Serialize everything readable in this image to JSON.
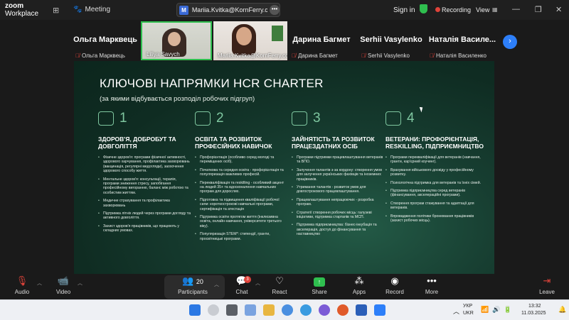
{
  "app": {
    "logo_line1": "zoom",
    "logo_line2": "Workplace",
    "meeting_label": "Meeting",
    "shared_by": "Mariia.Kvitka@KornFerry.com's sc",
    "shared_badge": "M",
    "sign_in": "Sign in",
    "recording": "Recording",
    "view": "View"
  },
  "participants": [
    {
      "big_name": "Ольга Марквець",
      "name": "Ольга Марквець",
      "muted": true,
      "video": false
    },
    {
      "big_name": "",
      "name": "Liliya Savych",
      "muted": false,
      "video": true
    },
    {
      "big_name": "",
      "name": "Mariia.Kvitka@KornFerry.com",
      "muted": false,
      "video": true
    },
    {
      "big_name": "Дарина Багмет",
      "name": "Дарина Багмет",
      "muted": true,
      "video": false
    },
    {
      "big_name": "Serhii Vasylenko",
      "name": "Serhii Vasylenko",
      "muted": true,
      "video": false
    },
    {
      "big_name": "Наталія Василе...",
      "name": "Наталія Василенко",
      "muted": true,
      "video": false
    }
  ],
  "slide": {
    "title": "КЛЮЧОВІ НАПРЯМКИ HCR CHARTER",
    "subtitle": "(за якими відбувається розподіл робочих підгруп)",
    "columns": [
      {
        "number": "1",
        "icon": "heart-icon",
        "title": "ЗДОРОВ'Я, ДОБРОБУТ ТА ДОВГОЛІТТЯ",
        "bullets": [
          "Фізичне здоров'я: програми фізичної активності, здорового харчування, профілактика захворювань (вакцинація, регулярні медогляди), заохочення здорового способу життя.",
          "Ментальне здоров'я: консультації, терапія, програми зниження стресу, запобігання професійному вигоранню, баланс між роботою та особистим життям.",
          "Медичне страхування та профілактика захворювань",
          "Підтримка літніх людей через програми догляду та активного довголіття.",
          "Захист здоров'я працівників, що працюють у складних умовах."
        ]
      },
      {
        "number": "2",
        "icon": "brain-icon",
        "title": "ОСВІТА ТА РОЗВИТОК ПРОФЕСІЙНИХ НАВИЧОК",
        "bullets": [
          "Профорієнтація (особливо серед молоді та переміщених осіб).",
          "Початкова та середня освіта - профорієнтація та популяризація важливих професій.",
          "Перекваліфікація та reskilling - особливий акцент на людей 35+ та вдосконалення навчальних програм для дорослих.",
          "Підготовка та підвищення кваліфікації робочої сили: короткострокові навчальні програми, сертифікація та атестація",
          "Підтримка освіти протягом життя (інклюзивна освіта, онлайн-навчання, університети третього віку).",
          "Популяризація STEM*: стипендії, гранти, просвітницькі програми."
        ]
      },
      {
        "number": "3",
        "icon": "growth-chart-icon",
        "title": "ЗАЙНЯТІСТЬ ТА РОЗВИТОК ПРАЦЕЗДАТНИХ ОСІБ",
        "bullets": [
          "Програми підтримки працевлаштування ветеранів та ВПО.",
          "Залучення талантів з-за кордону: створення умов для залучення українських фахівців та іноземних працівників.",
          "Утримання талантів - розвиток умов для довгострокового працевлаштування.",
          "Працевлаштування непрацюючих - розробка програм.",
          "Стратегії створення робочих місць: галузеві ініціативи, підтримка стартапів та МСП.",
          "Підтримка підприємництва: бізнес-інкубація та акселерація, доступ до фінансування та наставництво"
        ]
      },
      {
        "number": "4",
        "icon": "veteran-icon",
        "title": "ВЕТЕРАНИ: ПРОФОРІЄНТАЦІЯ, RESKILLING, ПІДПРИЄМНИЦТВО",
        "bullets": [
          "Програми перекваліфікації для ветеранів (навчання, гранти, кар'єрний коучинг).",
          "Врахування військового досвіду у професійному розвитку.",
          "Психологічна підтримка для ветеранів та їхніх сімей.",
          "Підтримка підприємництва серед ветеранів (фінансування, акселераційні програми).",
          "Створення програм стажування та адаптації для ветеранів.",
          "Впровадження політики бронювання працівників (захист робочих місць)."
        ]
      }
    ]
  },
  "toolbar": {
    "audio": "Audio",
    "video": "Video",
    "participants": "Participants",
    "participants_count": "20",
    "chat": "Chat",
    "chat_badge": "3",
    "react": "React",
    "share": "Share",
    "apps": "Apps",
    "record": "Record",
    "more": "More",
    "leave": "Leave"
  },
  "taskbar": {
    "lang_top": "УКР",
    "lang_bottom": "UKR",
    "time": "13:32",
    "date": "11.03.2025"
  }
}
